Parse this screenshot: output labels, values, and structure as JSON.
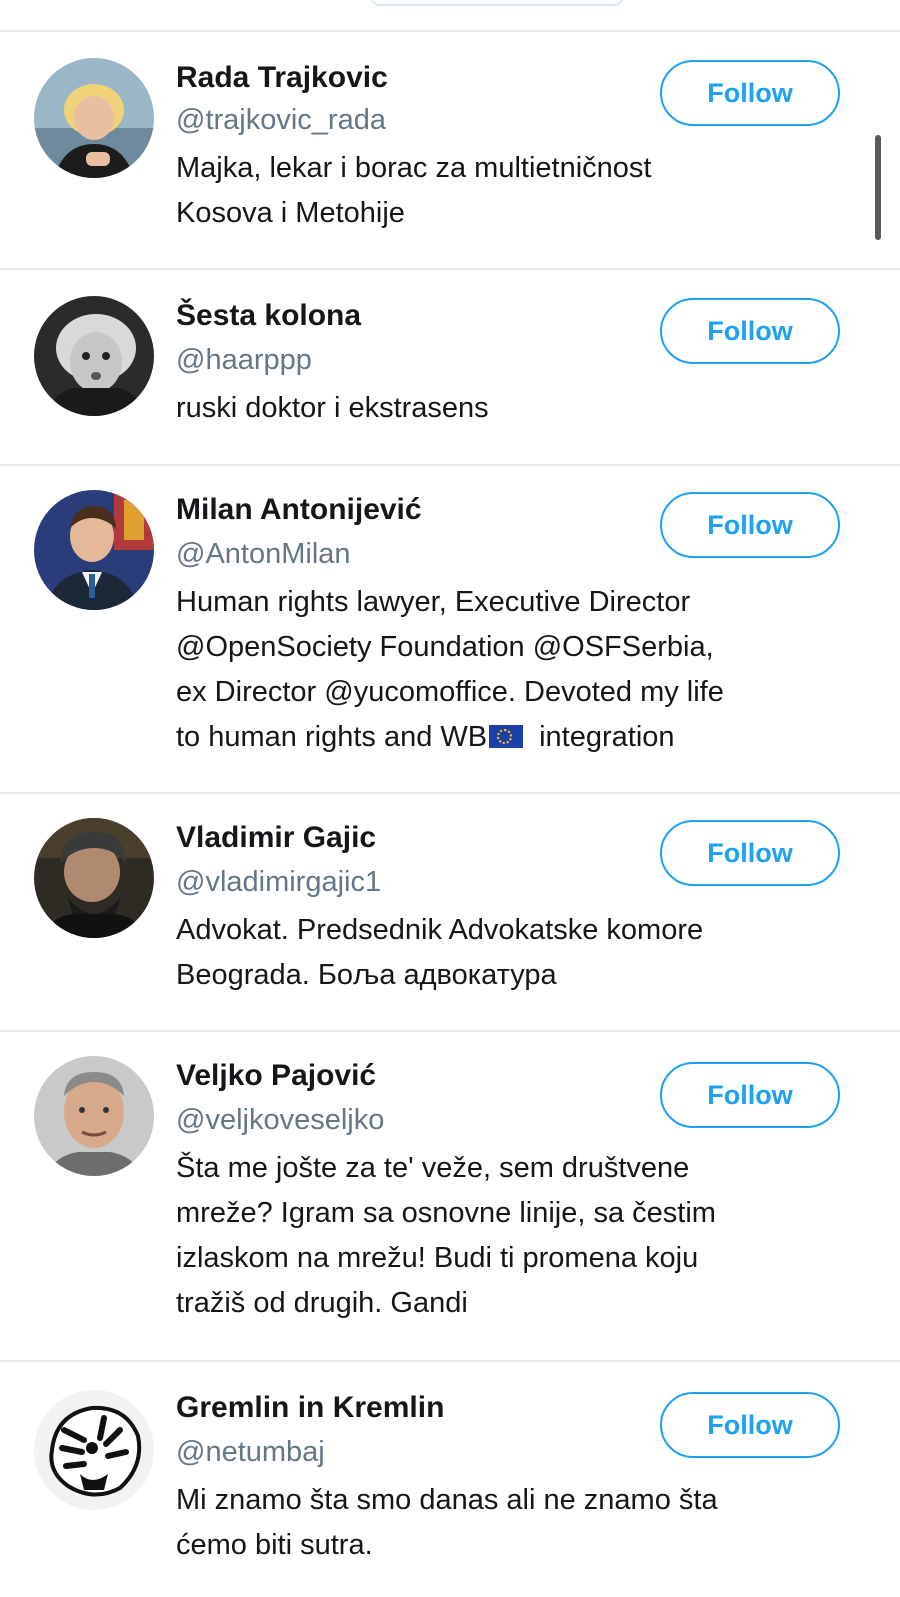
{
  "follow_suggestions": [
    {
      "name": "Rada Trajkovic",
      "handle": "@trajkovic_rada",
      "bio": [
        "Majka, lekar i borac za multietničnost",
        "Kosova i Metohije"
      ],
      "button": "Follow"
    },
    {
      "name": "Šesta kolona",
      "handle": "@haarppp",
      "bio": [
        "ruski doktor i ekstrasens"
      ],
      "button": "Follow"
    },
    {
      "name": "Milan Antonijević",
      "handle": "@AntonMilan",
      "bio": [
        "Human rights lawyer, Executive Director",
        "@OpenSociety Foundation @OSFSerbia,",
        "ex Director @yucomoffice. Devoted my life",
        "to human rights and WB"
      ],
      "bio_tail": "integration",
      "button": "Follow"
    },
    {
      "name": "Vladimir Gajic",
      "handle": "@vladimirgajic1",
      "bio": [
        "Advokat. Predsednik Advokatske komore",
        "Beograda. Боља адвокатура"
      ],
      "button": "Follow"
    },
    {
      "name": "Veljko Pajović",
      "handle": "@veljkoveseljko",
      "bio": [
        "Šta me jošte za te' veže, sem društvene",
        "mreže? Igram sa osnovne linije, sa čestim",
        "izlaskom na mrežu! Budi ti promena koju",
        "tražiš od drugih. Gandi"
      ],
      "button": "Follow"
    },
    {
      "name": "Gremlin in Kremlin",
      "handle": "@netumbaj",
      "bio": [
        "Mi znamo šta smo danas ali ne znamo šta",
        "ćemo biti sutra."
      ],
      "button": "Follow"
    }
  ],
  "icons": {
    "eu_flag": "eu-flag-icon"
  },
  "colors": {
    "accent": "#1da1f2",
    "handle": "#657786",
    "divider": "#e6ecf0"
  }
}
